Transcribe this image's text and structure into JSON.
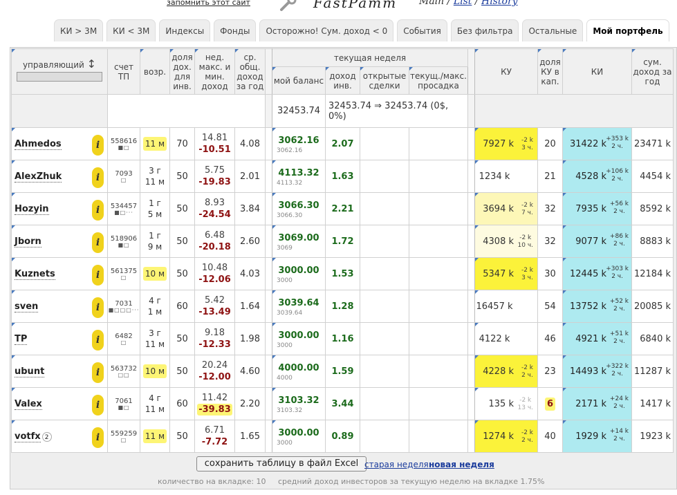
{
  "header": {
    "remember_link": "запомнить этот сайт",
    "logo_text": "FastPamm",
    "nav": [
      {
        "label": "Main",
        "link": false
      },
      {
        "label": "List",
        "link": true
      },
      {
        "label": "History",
        "link": true
      }
    ],
    "nav_sep": " / "
  },
  "tabs": [
    {
      "label": "КИ > 3М",
      "active": false
    },
    {
      "label": "КИ < 3М",
      "active": false
    },
    {
      "label": "Индексы",
      "active": false
    },
    {
      "label": "Фонды",
      "active": false
    },
    {
      "label": "Осторожно! Сум. доход < 0",
      "active": false
    },
    {
      "label": "События",
      "active": false
    },
    {
      "label": "Без фильтра",
      "active": false
    },
    {
      "label": "Остальные",
      "active": false
    },
    {
      "label": "Мой портфель",
      "active": true
    }
  ],
  "table": {
    "headers": {
      "manager": "управляющий",
      "sort_icon": "sort-updown-icon",
      "account": "счет ТП",
      "age": "возр.",
      "share": "доля дох. для инв.",
      "dd": "нед. макс. и мин. доход",
      "avg": "ср. общ. доход за год",
      "current_week": "текущая неделя",
      "balance": "мой баланс",
      "income": "доход инв.",
      "open_deals": "открытые сделки",
      "drawdown": "текущ./макс. просадка",
      "ku": "КУ",
      "ku_share": "доля КУ в кап.",
      "ki": "КИ",
      "sum_income": "сум. доход за год"
    },
    "summary": {
      "balance": "32453.74",
      "income": "32453.74 ⇒ 32453.74 (0$, 0%)"
    },
    "rows": [
      {
        "name": "Ahmedos",
        "badge": "",
        "account": "558616",
        "dots": "■□",
        "age": "11 м",
        "age_hl": true,
        "share": "70",
        "dd_max": "14.81",
        "dd_min": "-10.51",
        "dd_min_hl": false,
        "avg": "4.08",
        "balance": "3062.16",
        "balance_sub": "3062.16",
        "income": "2.07",
        "ku": "7927 k",
        "ku_delta": "-2 k",
        "ku_time": "3 ч.",
        "ku_style": "y",
        "ku_share": "20",
        "ku_share_hl": false,
        "ki": "31422 k",
        "ki_delta": "+353 k",
        "ki_time": "2 ч.",
        "sum": "23471 k"
      },
      {
        "name": "AlexZhuk",
        "badge": "",
        "account": "7093",
        "dots": "□",
        "age": "3 г\n11 м",
        "age_hl": false,
        "share": "50",
        "dd_max": "5.75",
        "dd_min": "-19.83",
        "dd_min_hl": false,
        "avg": "2.01",
        "balance": "4113.32",
        "balance_sub": "4113.32",
        "income": "1.63",
        "ku": "1234 k",
        "ku_delta": "",
        "ku_time": "",
        "ku_style": "",
        "ku_share": "21",
        "ku_share_hl": false,
        "ki": "4528 k",
        "ki_delta": "+106 k",
        "ki_time": "2 ч.",
        "sum": "4454 k"
      },
      {
        "name": "Hozyin",
        "badge": "",
        "account": "534457",
        "dots": "■□···",
        "age": "1 г\n5 м",
        "age_hl": false,
        "share": "50",
        "dd_max": "8.93",
        "dd_min": "-24.54",
        "dd_min_hl": false,
        "avg": "3.84",
        "balance": "3066.30",
        "balance_sub": "3066.30",
        "income": "2.21",
        "ku": "3694 k",
        "ku_delta": "-2 k",
        "ku_time": "7 ч.",
        "ku_style": "y2",
        "ku_share": "32",
        "ku_share_hl": false,
        "ki": "7935 k",
        "ki_delta": "+56 k",
        "ki_time": "2 ч.",
        "sum": "8592 k"
      },
      {
        "name": "Jborn",
        "badge": "",
        "account": "518906",
        "dots": "■□",
        "age": "1 г\n9 м",
        "age_hl": false,
        "share": "50",
        "dd_max": "6.48",
        "dd_min": "-20.18",
        "dd_min_hl": false,
        "avg": "2.60",
        "balance": "3069.00",
        "balance_sub": "3069",
        "income": "1.72",
        "ku": "4308 k",
        "ku_delta": "-2 k",
        "ku_time": "10 ч.",
        "ku_style": "y3",
        "ku_share": "32",
        "ku_share_hl": false,
        "ki": "9077 k",
        "ki_delta": "+86 k",
        "ki_time": "2 ч.",
        "sum": "8883 k"
      },
      {
        "name": "Kuznets",
        "badge": "",
        "account": "561375",
        "dots": "□",
        "age": "10 м",
        "age_hl": true,
        "share": "50",
        "dd_max": "10.48",
        "dd_min": "-12.06",
        "dd_min_hl": false,
        "avg": "4.03",
        "balance": "3000.00",
        "balance_sub": "3000",
        "income": "1.53",
        "ku": "5347 k",
        "ku_delta": "-2 k",
        "ku_time": "3 ч.",
        "ku_style": "y",
        "ku_share": "30",
        "ku_share_hl": false,
        "ki": "12445 k",
        "ki_delta": "+303 k",
        "ki_time": "2 ч.",
        "sum": "12184 k"
      },
      {
        "name": "sven",
        "badge": "",
        "account": "7031",
        "dots": "■□□□···",
        "age": "4 г\n1 м",
        "age_hl": false,
        "share": "60",
        "dd_max": "5.42",
        "dd_min": "-13.49",
        "dd_min_hl": false,
        "avg": "1.64",
        "balance": "3039.64",
        "balance_sub": "3039.64",
        "income": "1.28",
        "ku": "16457 k",
        "ku_delta": "",
        "ku_time": "",
        "ku_style": "",
        "ku_share": "54",
        "ku_share_hl": false,
        "ki": "13752 k",
        "ki_delta": "+52 k",
        "ki_time": "2 ч.",
        "sum": "20085 k"
      },
      {
        "name": "TP",
        "badge": "",
        "account": "6482",
        "dots": "□",
        "age": "3 г\n11 м",
        "age_hl": false,
        "share": "50",
        "dd_max": "9.18",
        "dd_min": "-12.33",
        "dd_min_hl": false,
        "avg": "1.98",
        "balance": "3000.00",
        "balance_sub": "3000",
        "income": "1.16",
        "ku": "4122 k",
        "ku_delta": "",
        "ku_time": "",
        "ku_style": "",
        "ku_share": "46",
        "ku_share_hl": false,
        "ki": "4921 k",
        "ki_delta": "+51 k",
        "ki_time": "2 ч.",
        "sum": "6840 k"
      },
      {
        "name": "ubunt",
        "badge": "",
        "account": "563732",
        "dots": "□□",
        "age": "10 м",
        "age_hl": true,
        "share": "50",
        "dd_max": "20.24",
        "dd_min": "-12.00",
        "dd_min_hl": false,
        "avg": "4.60",
        "balance": "4000.00",
        "balance_sub": "4000",
        "income": "1.59",
        "ku": "4228 k",
        "ku_delta": "-2 k",
        "ku_time": "2 ч.",
        "ku_style": "y",
        "ku_share": "23",
        "ku_share_hl": false,
        "ki": "14493 k",
        "ki_delta": "+322 k",
        "ki_time": "2 ч.",
        "sum": "11287 k"
      },
      {
        "name": "Valex",
        "badge": "",
        "account": "7061",
        "dots": "■□",
        "age": "4 г\n11 м",
        "age_hl": false,
        "share": "60",
        "dd_max": "11.42",
        "dd_min": "-39.83",
        "dd_min_hl": true,
        "avg": "2.20",
        "balance": "3103.32",
        "balance_sub": "3103.32",
        "income": "3.44",
        "ku": "135 k",
        "ku_delta": "-2 k",
        "ku_time": "13 ч.",
        "ku_style": "g",
        "ku_share": "6",
        "ku_share_hl": true,
        "ki": "2171 k",
        "ki_delta": "+24 k",
        "ki_time": "2 ч.",
        "sum": "1417 k"
      },
      {
        "name": "votfx",
        "badge": "2",
        "account": "559259",
        "dots": "□",
        "age": "11 м",
        "age_hl": true,
        "share": "50",
        "dd_max": "6.71",
        "dd_min": "-7.72",
        "dd_min_hl": false,
        "avg": "1.65",
        "balance": "3000.00",
        "balance_sub": "3000",
        "income": "0.89",
        "ku": "1274 k",
        "ku_delta": "-2 k",
        "ku_time": "2 ч.",
        "ku_style": "y",
        "ku_share": "40",
        "ku_share_hl": false,
        "ki": "1929 k",
        "ki_delta": "+14 k",
        "ki_time": "2 ч.",
        "sum": "1923 k"
      }
    ]
  },
  "footer": {
    "save_button": "сохранить таблицу в файл Excel",
    "old_week": "старая неделя",
    "new_week": "новая неделя",
    "stats": "количество на вкладке: 10     средний доход инвесторов за текущую неделю на вкладке 1.75%"
  },
  "colors": {
    "highlight": "#fdf575",
    "ku_yellow": "#fbf23a",
    "ki_cyan": "#aeeaf0",
    "positive": "#1c6b1c",
    "negative": "#8e1212",
    "info_icon": "#f0d21c"
  },
  "icons": {
    "logo": "wrench-icon",
    "info": "info-icon"
  }
}
